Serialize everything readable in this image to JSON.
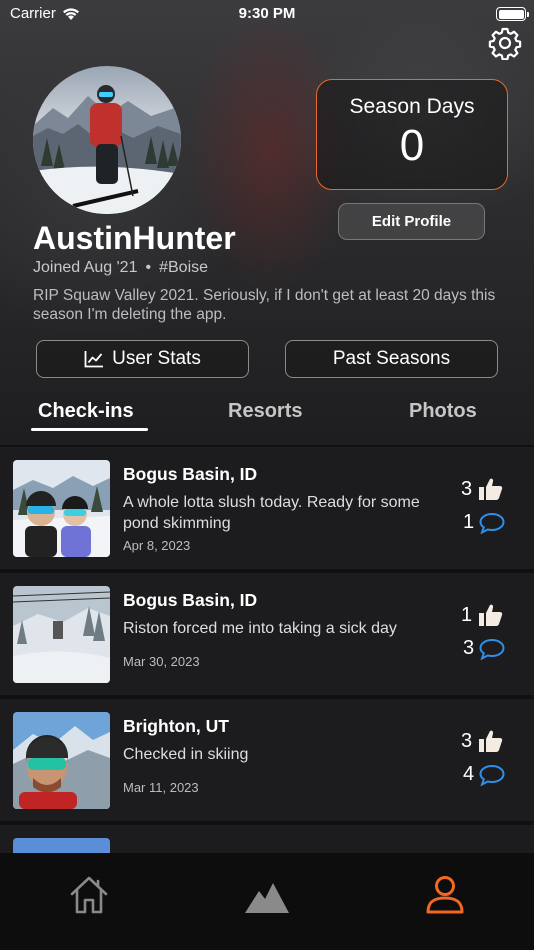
{
  "status_bar": {
    "carrier": "Carrier",
    "time": "9:30 PM"
  },
  "profile": {
    "username": "AustinHunter",
    "joined": "Joined Aug '21",
    "separator": "•",
    "location_tag": "#Boise",
    "bio": "RIP Squaw Valley 2021. Seriously, if I don't get at least 20 days this season I'm deleting the app.",
    "season_days_label": "Season Days",
    "season_days_value": "0",
    "edit_profile_label": "Edit Profile",
    "user_stats_label": "User Stats",
    "past_seasons_label": "Past Seasons"
  },
  "tabs": [
    {
      "label": "Check-ins",
      "active": true
    },
    {
      "label": "Resorts",
      "active": false
    },
    {
      "label": "Photos",
      "active": false
    }
  ],
  "checkins": [
    {
      "resort": "Bogus Basin, ID",
      "text": "A whole lotta slush today. Ready for some pond skimming",
      "date": "Apr 8, 2023",
      "likes": "3",
      "comments": "1"
    },
    {
      "resort": "Bogus Basin, ID",
      "text": "Riston forced me into taking a sick day",
      "date": "Mar 30, 2023",
      "likes": "1",
      "comments": "3"
    },
    {
      "resort": "Brighton, UT",
      "text": "Checked in skiing",
      "date": "Mar 11, 2023",
      "likes": "3",
      "comments": "4"
    }
  ],
  "nav": [
    {
      "icon": "home-icon",
      "active": false
    },
    {
      "icon": "mountain-icon",
      "active": false
    },
    {
      "icon": "profile-icon",
      "active": true
    }
  ],
  "colors": {
    "accent": "#f26722",
    "comment_blue": "#2f8fe8",
    "like": "#f4ece2"
  }
}
